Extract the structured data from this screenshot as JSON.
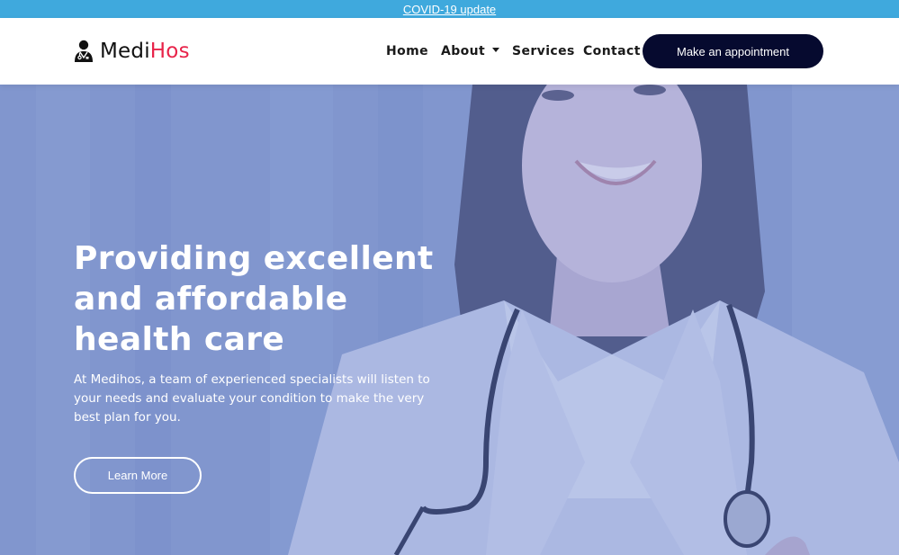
{
  "topbar": {
    "link": "COVID-19 update",
    "color": "#3fa9dd"
  },
  "brand": {
    "name_part1": "Medi",
    "name_part2": "Hos",
    "accent_color": "#e8244a",
    "icon": "doctor-icon"
  },
  "nav": {
    "items": [
      {
        "label": "Home"
      },
      {
        "label": "About",
        "icon": "caret-down-icon"
      },
      {
        "label": "Services"
      },
      {
        "label": "Contact"
      }
    ],
    "cta_label": "Make an appointment",
    "cta_color": "#060a2f"
  },
  "hero": {
    "title": "Providing excellent and affordable health care",
    "description": "At Medihos, a team of experienced specialists will listen to your needs and evaluate your condition to make the very best plan for you.",
    "button_label": "Learn More",
    "overlay_color": "#7f96cf"
  }
}
